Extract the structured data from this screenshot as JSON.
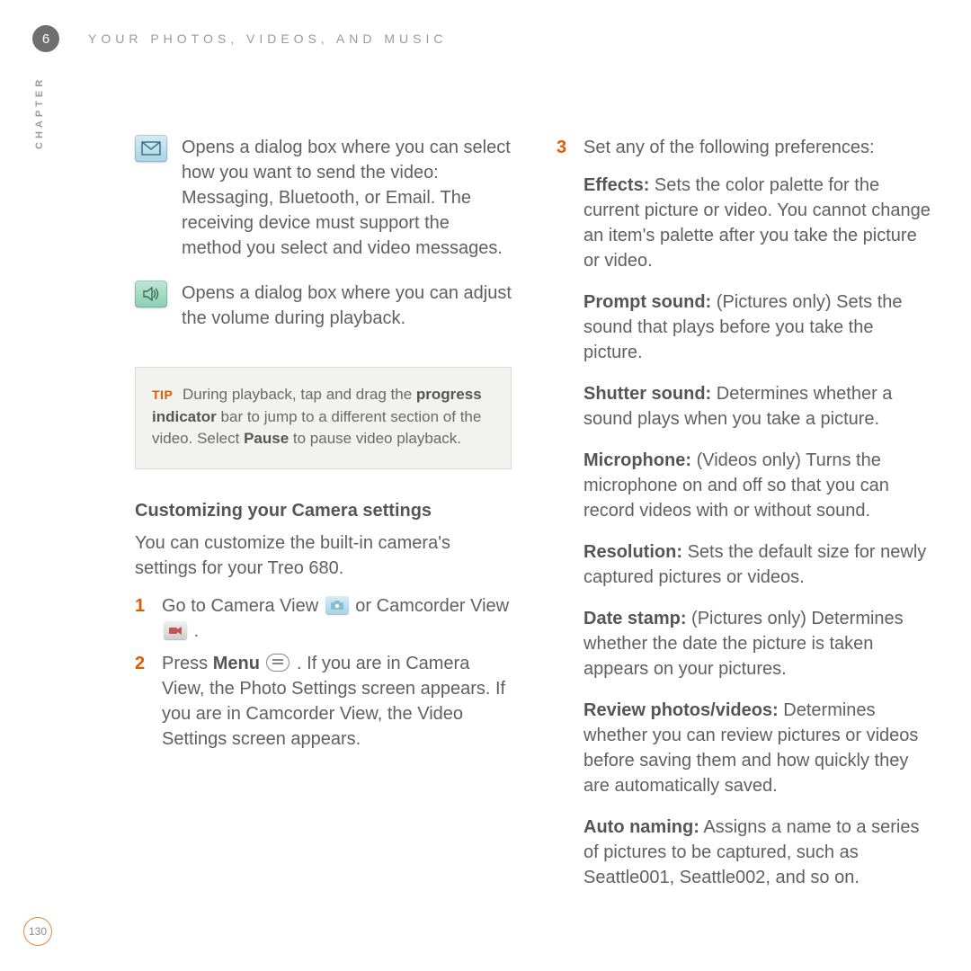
{
  "header": {
    "chapter_number": "6",
    "title": "YOUR PHOTOS, VIDEOS, AND MUSIC",
    "chapter_label": "CHAPTER"
  },
  "left": {
    "icon_items": [
      {
        "icon": "envelope-icon",
        "text": "Opens a dialog box where you can select how you want to send the video: Messaging, Bluetooth, or Email. The receiving device must support the method you select and video messages."
      },
      {
        "icon": "speaker-icon",
        "text": "Opens a dialog box where you can adjust the volume during playback."
      }
    ],
    "tip": {
      "label": "TIP",
      "text_parts": {
        "p1": "During playback, tap and drag the ",
        "b1": "progress indicator",
        "p2": " bar to jump to a different section of the video. Select ",
        "b2": "Pause",
        "p3": " to pause video playback."
      }
    },
    "section_heading": "Customizing your Camera settings",
    "intro": "You can customize the built-in camera's settings for your Treo 680.",
    "steps": [
      {
        "num": "1",
        "parts": {
          "p1": "Go to Camera View ",
          "p2": " or Camcorder View ",
          "p3": " ."
        }
      },
      {
        "num": "2",
        "parts": {
          "p1": "Press ",
          "b1": "Menu",
          "p2": " . If you are in Camera View, the Photo Settings screen appears. If you are in Camcorder View, the Video Settings screen appears."
        }
      }
    ]
  },
  "right": {
    "step3": {
      "num": "3",
      "lead": "Set any of the following preferences:"
    },
    "prefs": [
      {
        "label": "Effects:",
        "text": " Sets the color palette for the current picture or video. You cannot change an item's palette after you take the picture or video."
      },
      {
        "label": "Prompt sound:",
        "text": " (Pictures only) Sets the sound that plays before you take the picture."
      },
      {
        "label": "Shutter sound:",
        "text": " Determines whether a sound plays when you take a picture."
      },
      {
        "label": "Microphone:",
        "text": " (Videos only) Turns the microphone on and off so that you can record videos with or without sound."
      },
      {
        "label": "Resolution:",
        "text": " Sets the default size for newly captured pictures or videos."
      },
      {
        "label": "Date stamp:",
        "text": " (Pictures only) Determines whether the date the picture is taken appears on your pictures."
      },
      {
        "label": "Review photos/videos:",
        "text": " Determines whether you can review pictures or videos before saving them and how quickly they are automatically saved."
      },
      {
        "label": "Auto naming:",
        "text": " Assigns a name to a series of pictures to be captured, such as Seattle001, Seattle002, and so on."
      }
    ]
  },
  "page_number": "130"
}
